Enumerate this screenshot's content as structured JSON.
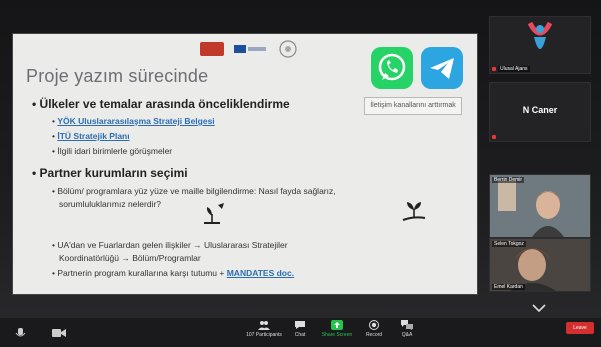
{
  "slide": {
    "title": "Proje yazım sürecinde",
    "callout": "İletişim kanallarını arttırmak",
    "bullet1": "Ülkeler ve temalar arasında önceliklendirme",
    "bullet1_items": [
      "YÖK Uluslararasılaşma Strateji Belgesi",
      "İTÜ Stratejik Planı",
      "İlgili idari birimlerle görüşmeler"
    ],
    "bullet2": "Partner kurumların seçimi",
    "bullet2_item1_line1": "Bölüm/ programlara yüz yüze ve maille bilgilendirme: Nasıl fayda sağlarız,",
    "bullet2_item1_line2": "sorumluluklarımız nelerdir?",
    "bullet2_item2_line1": "UA'dan ve Fuarlardan gelen ilişkiler → Uluslararası Stratejiler",
    "bullet2_item2_line2": "Koordinatörlüğü → Bölüm/Programlar",
    "bullet2_item3_prefix": "Partnerin program kurallarına karşı tutumu + ",
    "bullet2_item3_link": "MANDATES doc."
  },
  "gallery": {
    "participant1": "Ulusal Ajans",
    "participant2": "N Caner",
    "participant3": "Berrin Demir",
    "participant4": "Selen Tokgoz",
    "participant5": "Emel Kardan"
  },
  "toolbar": {
    "participants_count": "107",
    "participants_label": "Participants",
    "chat_label": "Chat",
    "share_label": "Share Screen",
    "record_label": "Record",
    "qa_label": "Q&A",
    "leave_label": "Leave"
  },
  "colors": {
    "share_green": "#27c24c",
    "leave_red": "#d32f2f",
    "link_blue": "#2a6db5"
  }
}
